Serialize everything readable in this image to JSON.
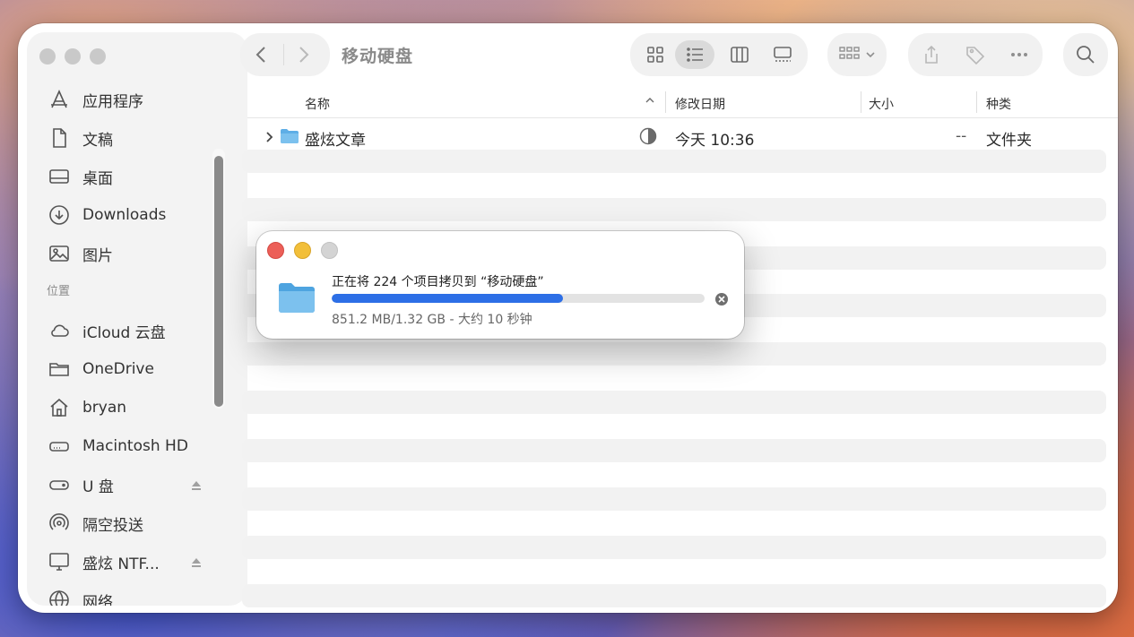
{
  "window": {
    "title": "移动硬盘"
  },
  "sidebar": {
    "favorites": [
      {
        "label": "应用程序",
        "icon": "applications-icon"
      },
      {
        "label": "文稿",
        "icon": "document-icon"
      },
      {
        "label": "桌面",
        "icon": "desktop-icon"
      },
      {
        "label": "Downloads",
        "icon": "downloads-icon"
      },
      {
        "label": "图片",
        "icon": "pictures-icon"
      }
    ],
    "locations_heading": "位置",
    "locations": [
      {
        "label": "iCloud 云盘",
        "icon": "cloud-icon"
      },
      {
        "label": "OneDrive",
        "icon": "folder-icon"
      },
      {
        "label": "bryan",
        "icon": "home-icon"
      },
      {
        "label": "Macintosh HD",
        "icon": "harddrive-icon"
      },
      {
        "label": "U 盘",
        "icon": "external-drive-icon",
        "ejectable": true
      },
      {
        "label": "隔空投送",
        "icon": "airdrop-icon"
      },
      {
        "label": "盛炫 NTF...",
        "icon": "monitor-icon",
        "ejectable": true
      },
      {
        "label": "网络",
        "icon": "network-icon"
      }
    ]
  },
  "toolbar": {
    "view_modes": [
      "icon-view",
      "list-view",
      "column-view",
      "gallery-view"
    ],
    "active_view": "list-view"
  },
  "columns": {
    "name": "名称",
    "date": "修改日期",
    "size": "大小",
    "kind": "种类"
  },
  "files": [
    {
      "name": "盛炫文章",
      "modified": "今天 10:36",
      "size": "--",
      "kind": "文件夹"
    }
  ],
  "copy_dialog": {
    "title": "正在将 224 个项目拷贝到 “移动硬盘”",
    "status": "851.2 MB/1.32 GB - 大约 10 秒钟",
    "progress_fraction": 0.62
  },
  "colors": {
    "accent": "#2d6fe6",
    "folder": "#6cb4ea",
    "close": "#ec5f58",
    "minimize": "#f2bf3a"
  }
}
